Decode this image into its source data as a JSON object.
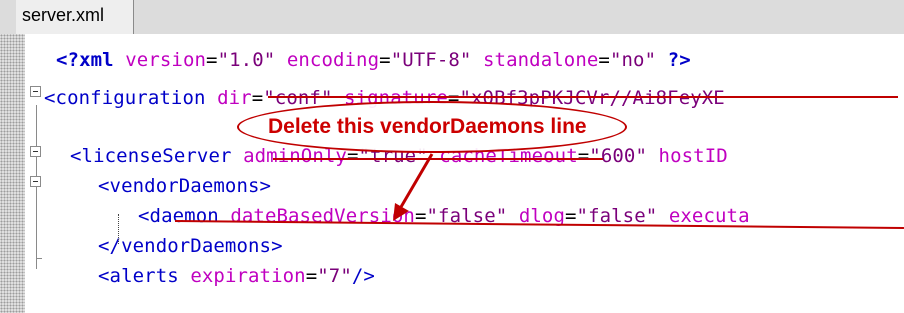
{
  "tab": {
    "label": "server.xml"
  },
  "editor": {
    "lines": [
      {
        "tokens": [
          {
            "t": "<?xml",
            "c": "tk-pi"
          },
          {
            "t": " "
          },
          {
            "t": "version",
            "c": "tk-attr"
          },
          {
            "t": "=",
            "c": "tk-eq"
          },
          {
            "t": "\"1.0\"",
            "c": "tk-val"
          },
          {
            "t": " "
          },
          {
            "t": "encoding",
            "c": "tk-attr"
          },
          {
            "t": "=",
            "c": "tk-eq"
          },
          {
            "t": "\"UTF-8\"",
            "c": "tk-val"
          },
          {
            "t": " "
          },
          {
            "t": "standalone",
            "c": "tk-attr"
          },
          {
            "t": "=",
            "c": "tk-eq"
          },
          {
            "t": "\"no\"",
            "c": "tk-val"
          },
          {
            "t": " "
          },
          {
            "t": "?>",
            "c": "tk-pi"
          }
        ]
      },
      {
        "tokens": [
          {
            "t": "<configuration",
            "c": "tk-tag"
          },
          {
            "t": " "
          },
          {
            "t": "dir",
            "c": "tk-attr"
          },
          {
            "t": "=",
            "c": "tk-eq"
          },
          {
            "t": "\"conf\"",
            "c": "tk-val"
          },
          {
            "t": " "
          },
          {
            "t": "signature",
            "c": "tk-attr"
          },
          {
            "t": "=",
            "c": "tk-eq"
          },
          {
            "t": "\"x0Bf3pPKJCVr//Ai8FeyXE",
            "c": "tk-val"
          }
        ]
      },
      {
        "tokens": []
      },
      {
        "tokens": [
          {
            "t": "<licenseServer",
            "c": "tk-tag"
          },
          {
            "t": " "
          },
          {
            "t": "adminOnly",
            "c": "tk-attr"
          },
          {
            "t": "=",
            "c": "tk-eq"
          },
          {
            "t": "\"true\"",
            "c": "tk-val"
          },
          {
            "t": " "
          },
          {
            "t": "cacheTimeout",
            "c": "tk-attr"
          },
          {
            "t": "=",
            "c": "tk-eq"
          },
          {
            "t": "\"600\"",
            "c": "tk-val"
          },
          {
            "t": " "
          },
          {
            "t": "hostID",
            "c": "tk-attr"
          }
        ]
      },
      {
        "tokens": [
          {
            "t": "<vendorDaemons>",
            "c": "tk-tag"
          }
        ]
      },
      {
        "tokens": [
          {
            "t": "<daemon",
            "c": "tk-tag"
          },
          {
            "t": " "
          },
          {
            "t": "dateBasedVersion",
            "c": "tk-attr"
          },
          {
            "t": "=",
            "c": "tk-eq"
          },
          {
            "t": "\"false\"",
            "c": "tk-val"
          },
          {
            "t": " "
          },
          {
            "t": "dlog",
            "c": "tk-attr"
          },
          {
            "t": "=",
            "c": "tk-eq"
          },
          {
            "t": "\"false\"",
            "c": "tk-val"
          },
          {
            "t": " "
          },
          {
            "t": "executa",
            "c": "tk-attr"
          }
        ]
      },
      {
        "tokens": [
          {
            "t": "</vendorDaemons>",
            "c": "tk-tag"
          }
        ]
      },
      {
        "tokens": [
          {
            "t": "<alerts",
            "c": "tk-tag"
          },
          {
            "t": " "
          },
          {
            "t": "expiration",
            "c": "tk-attr"
          },
          {
            "t": "=",
            "c": "tk-eq"
          },
          {
            "t": "\"7\"",
            "c": "tk-val"
          },
          {
            "t": "/>",
            "c": "tk-tag"
          }
        ]
      }
    ]
  },
  "annotation": {
    "callout_text": "Delete this vendorDaemons line",
    "color": "#cc0000"
  },
  "colors": {
    "tag": "#0000c8",
    "attribute": "#c000c0",
    "value": "#7a007a"
  }
}
